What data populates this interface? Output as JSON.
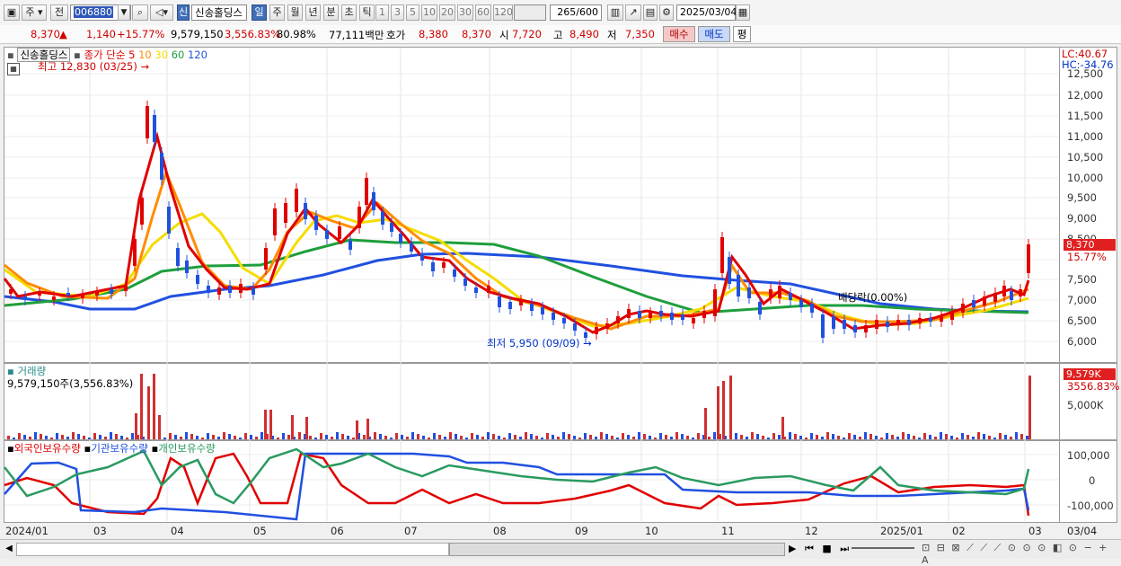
{
  "toolbar": {
    "period_type": "주",
    "prev_label": "전",
    "stock_code": "006880",
    "market_badge": "신",
    "stock_name": "신송홀딩스",
    "periods": [
      "일",
      "주",
      "월",
      "년",
      "분",
      "초",
      "틱"
    ],
    "active_period": "일",
    "intervals": [
      "1",
      "3",
      "5",
      "10",
      "20",
      "30",
      "60",
      "120"
    ],
    "count": "265",
    "count_total": "/600",
    "date": "2025/03/04"
  },
  "quote": {
    "price": "8,370",
    "up_arrow": "▲",
    "change": "1,140",
    "change_pct": "+15.77%",
    "volume": "9,579,150",
    "volume_pct": "3,556.83%",
    "ratio": "80.98%",
    "amount": "77,111백만",
    "hoga_label": "호가",
    "bid1": "8,380",
    "bid2": "8,370",
    "open_label": "시",
    "open": "7,720",
    "high_label": "고",
    "high": "8,490",
    "low_label": "저",
    "low": "7,350",
    "buy": "매수",
    "sell": "매도",
    "eval": "평"
  },
  "price_pane": {
    "stock_name": "신송홀딩스",
    "ma_label": "종가 단순",
    "ma_periods": [
      "5",
      "10",
      "30",
      "60",
      "120"
    ],
    "ma_colors": [
      "#e00000",
      "#ff8c00",
      "#f5dc00",
      "#1e9e3c",
      "#2050e0"
    ],
    "high_note": "최고 12,830 (03/25)",
    "low_note": "최저 5,950 (09/09)",
    "dividend_note": "배당락(0.00%)",
    "lc": "LC:40.67",
    "hc": "HC:-34.76",
    "y_ticks": [
      "12,500",
      "12,000",
      "11,500",
      "11,000",
      "10,500",
      "10,000",
      "9,500",
      "9,000",
      "8,500",
      "7,500",
      "7,000",
      "6,500",
      "6,000"
    ],
    "last_tag": "8,370",
    "last_pct": "15.77%"
  },
  "volume_pane": {
    "title": "거래량",
    "value_text": "9,579,150주(3,556.83%)",
    "tick": "5,000K",
    "tag": "9,579K",
    "tag_pct": "3556.83%"
  },
  "holding_pane": {
    "series": [
      "외국인보유수량",
      "기관보유수량",
      "개인보유수량"
    ],
    "colors": [
      "#e00000",
      "#2050e0",
      "#2a9a60"
    ],
    "ticks": [
      "100,000",
      "0",
      "-100,000"
    ]
  },
  "x_axis": [
    "2024/01",
    "03",
    "04",
    "05",
    "06",
    "07",
    "08",
    "09",
    "10",
    "11",
    "12",
    "2025/01",
    "02",
    "03",
    "03/04"
  ]
}
